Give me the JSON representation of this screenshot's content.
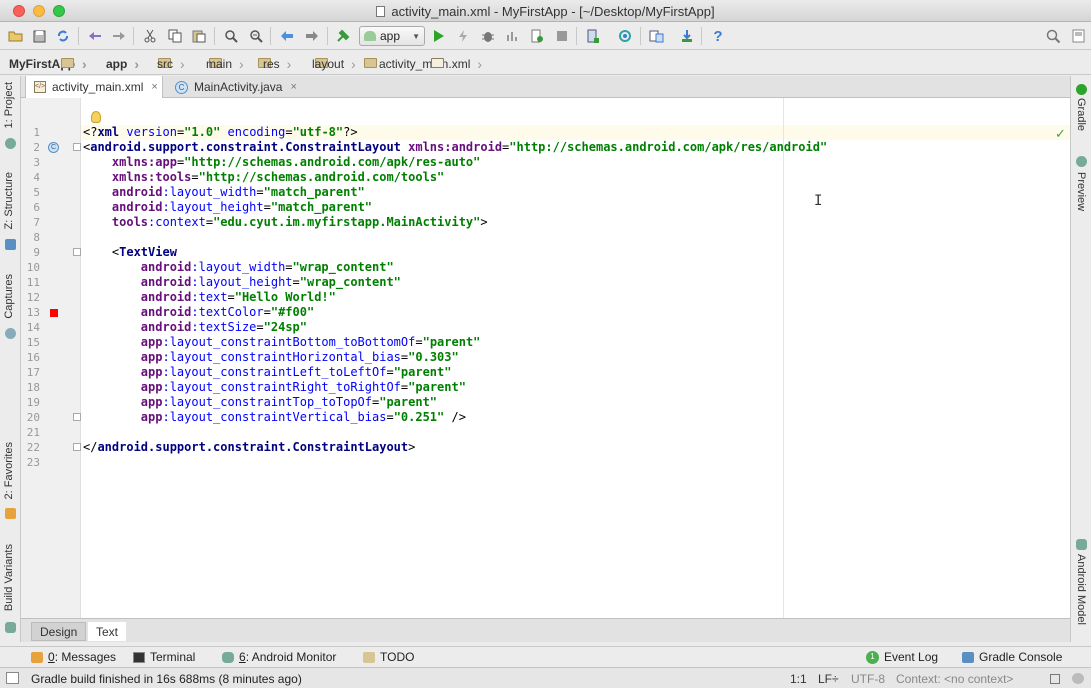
{
  "window": {
    "title": "activity_main.xml - MyFirstApp - [~/Desktop/MyFirstApp]"
  },
  "toolbar": {
    "run_config": "app",
    "icons": [
      "open-folder-icon",
      "save-icon",
      "sync-icon",
      "undo-icon",
      "redo-icon",
      "cut-icon",
      "copy-icon",
      "paste-icon",
      "find-icon",
      "replace-icon",
      "back-icon",
      "forward-icon",
      "build-icon",
      "run-icon",
      "apply-changes-icon",
      "debug-icon",
      "profile-icon",
      "attach-debugger-icon",
      "stop-icon",
      "avd-manager-icon",
      "sync-gradle-icon",
      "project-structure-icon",
      "sdk-manager-icon",
      "help-icon",
      "search-everywhere-icon"
    ],
    "help_glyph": "?"
  },
  "breadcrumbs": [
    "MyFirstApp",
    "app",
    "src",
    "main",
    "res",
    "layout",
    "activity_main.xml"
  ],
  "left_tools": [
    "1: Project",
    "Z: Structure",
    "Captures",
    "2: Favorites",
    "Build Variants"
  ],
  "right_tools": [
    "Gradle",
    "Preview",
    "Android Model"
  ],
  "editor_tabs": [
    {
      "label": "activity_main.xml",
      "active": true,
      "type_glyph": "</>"
    },
    {
      "label": "MainActivity.java",
      "active": false,
      "type_glyph": "C"
    }
  ],
  "tab_close_glyph": "×",
  "gutter_marker_glyph": "C",
  "check_glyph": "✓",
  "cursor_glyph": "I",
  "code": {
    "lines": [
      {
        "n": "1",
        "parts": [
          [
            "t-plain",
            "<?"
          ],
          [
            "t-tag",
            "xml "
          ],
          [
            "t-attr",
            "version"
          ],
          [
            "t-plain",
            "="
          ],
          [
            "t-val",
            "\"1.0\""
          ],
          [
            "t-plain",
            " "
          ],
          [
            "t-attr",
            "encoding"
          ],
          [
            "t-plain",
            "="
          ],
          [
            "t-val",
            "\"utf-8\""
          ],
          [
            "t-plain",
            "?>"
          ]
        ]
      },
      {
        "n": "2",
        "parts": [
          [
            "t-plain",
            "<"
          ],
          [
            "t-tag",
            "android.support.constraint.ConstraintLayout "
          ],
          [
            "t-ns",
            "xmlns:android"
          ],
          [
            "t-plain",
            "="
          ],
          [
            "t-val",
            "\"http://schemas.android.com/apk/res/android\""
          ]
        ]
      },
      {
        "n": "3",
        "parts": [
          [
            "t-plain",
            "    "
          ],
          [
            "t-ns",
            "xmlns:app"
          ],
          [
            "t-plain",
            "="
          ],
          [
            "t-val",
            "\"http://schemas.android.com/apk/res-auto\""
          ]
        ]
      },
      {
        "n": "4",
        "parts": [
          [
            "t-plain",
            "    "
          ],
          [
            "t-ns",
            "xmlns:tools"
          ],
          [
            "t-plain",
            "="
          ],
          [
            "t-val",
            "\"http://schemas.android.com/tools\""
          ]
        ]
      },
      {
        "n": "5",
        "parts": [
          [
            "t-plain",
            "    "
          ],
          [
            "t-ns",
            "android"
          ],
          [
            "t-attr",
            ":layout_width"
          ],
          [
            "t-plain",
            "="
          ],
          [
            "t-val",
            "\"match_parent\""
          ]
        ]
      },
      {
        "n": "6",
        "parts": [
          [
            "t-plain",
            "    "
          ],
          [
            "t-ns",
            "android"
          ],
          [
            "t-attr",
            ":layout_height"
          ],
          [
            "t-plain",
            "="
          ],
          [
            "t-val",
            "\"match_parent\""
          ]
        ]
      },
      {
        "n": "7",
        "parts": [
          [
            "t-plain",
            "    "
          ],
          [
            "t-ns",
            "tools"
          ],
          [
            "t-attr",
            ":context"
          ],
          [
            "t-plain",
            "="
          ],
          [
            "t-val",
            "\"edu.cyut.im.myfirstapp.MainActivity\""
          ],
          [
            "t-plain",
            ">"
          ]
        ]
      },
      {
        "n": "8",
        "parts": []
      },
      {
        "n": "9",
        "parts": [
          [
            "t-plain",
            "    <"
          ],
          [
            "t-tag",
            "TextView"
          ]
        ]
      },
      {
        "n": "10",
        "parts": [
          [
            "t-plain",
            "        "
          ],
          [
            "t-ns",
            "android"
          ],
          [
            "t-attr",
            ":layout_width"
          ],
          [
            "t-plain",
            "="
          ],
          [
            "t-val",
            "\"wrap_content\""
          ]
        ]
      },
      {
        "n": "11",
        "parts": [
          [
            "t-plain",
            "        "
          ],
          [
            "t-ns",
            "android"
          ],
          [
            "t-attr",
            ":layout_height"
          ],
          [
            "t-plain",
            "="
          ],
          [
            "t-val",
            "\"wrap_content\""
          ]
        ]
      },
      {
        "n": "12",
        "parts": [
          [
            "t-plain",
            "        "
          ],
          [
            "t-ns",
            "android"
          ],
          [
            "t-attr",
            ":text"
          ],
          [
            "t-plain",
            "="
          ],
          [
            "t-val",
            "\"Hello World!\""
          ]
        ]
      },
      {
        "n": "13",
        "parts": [
          [
            "t-plain",
            "        "
          ],
          [
            "t-ns",
            "android"
          ],
          [
            "t-attr",
            ":textColor"
          ],
          [
            "t-plain",
            "="
          ],
          [
            "t-val",
            "\"#f00\""
          ]
        ]
      },
      {
        "n": "14",
        "parts": [
          [
            "t-plain",
            "        "
          ],
          [
            "t-ns",
            "android"
          ],
          [
            "t-attr",
            ":textSize"
          ],
          [
            "t-plain",
            "="
          ],
          [
            "t-val",
            "\"24sp\""
          ]
        ]
      },
      {
        "n": "15",
        "parts": [
          [
            "t-plain",
            "        "
          ],
          [
            "t-ns",
            "app"
          ],
          [
            "t-attr",
            ":layout_constraintBottom_toBottomOf"
          ],
          [
            "t-plain",
            "="
          ],
          [
            "t-val",
            "\"parent\""
          ]
        ]
      },
      {
        "n": "16",
        "parts": [
          [
            "t-plain",
            "        "
          ],
          [
            "t-ns",
            "app"
          ],
          [
            "t-attr",
            ":layout_constraintHorizontal_bias"
          ],
          [
            "t-plain",
            "="
          ],
          [
            "t-val",
            "\"0.303\""
          ]
        ]
      },
      {
        "n": "17",
        "parts": [
          [
            "t-plain",
            "        "
          ],
          [
            "t-ns",
            "app"
          ],
          [
            "t-attr",
            ":layout_constraintLeft_toLeftOf"
          ],
          [
            "t-plain",
            "="
          ],
          [
            "t-val",
            "\"parent\""
          ]
        ]
      },
      {
        "n": "18",
        "parts": [
          [
            "t-plain",
            "        "
          ],
          [
            "t-ns",
            "app"
          ],
          [
            "t-attr",
            ":layout_constraintRight_toRightOf"
          ],
          [
            "t-plain",
            "="
          ],
          [
            "t-val",
            "\"parent\""
          ]
        ]
      },
      {
        "n": "19",
        "parts": [
          [
            "t-plain",
            "        "
          ],
          [
            "t-ns",
            "app"
          ],
          [
            "t-attr",
            ":layout_constraintTop_toTopOf"
          ],
          [
            "t-plain",
            "="
          ],
          [
            "t-val",
            "\"parent\""
          ]
        ]
      },
      {
        "n": "20",
        "parts": [
          [
            "t-plain",
            "        "
          ],
          [
            "t-ns",
            "app"
          ],
          [
            "t-attr",
            ":layout_constraintVertical_bias"
          ],
          [
            "t-plain",
            "="
          ],
          [
            "t-val",
            "\"0.251\""
          ],
          [
            "t-plain",
            " />"
          ]
        ]
      },
      {
        "n": "21",
        "parts": []
      },
      {
        "n": "22",
        "parts": [
          [
            "t-plain",
            "</"
          ],
          [
            "t-tag",
            "android.support.constraint.ConstraintLayout"
          ],
          [
            "t-plain",
            ">"
          ]
        ]
      },
      {
        "n": "23",
        "parts": []
      }
    ]
  },
  "mode_tabs": {
    "design": "Design",
    "text": "Text"
  },
  "bottom_tools": {
    "messages_num": "0",
    "messages": ": Messages",
    "terminal": "Terminal",
    "monitor_num": "6",
    "monitor": ": Android Monitor",
    "todo": "TODO",
    "event_log_count": "1",
    "event_log": "Event Log",
    "gradle_console": "Gradle Console"
  },
  "status": {
    "message": "Gradle build finished in 16s 688ms (8 minutes ago)",
    "position": "1:1",
    "line_sep": "LF÷",
    "encoding": "UTF-8",
    "context": "Context: <no context>"
  },
  "colors": {
    "accent_run": "#2aa52a",
    "highlight_line": "#fefbea"
  }
}
